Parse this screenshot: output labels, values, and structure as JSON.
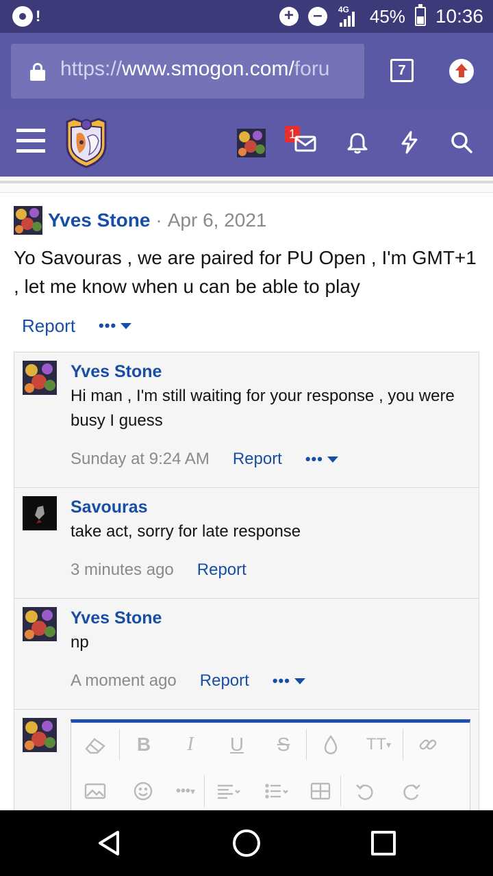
{
  "status_bar": {
    "battery": "45%",
    "time": "10:36",
    "network": "4G",
    "left_mark": "!"
  },
  "browser": {
    "url_protocol": "https://",
    "url_host": "www.smogon.com/",
    "url_rest": "foru",
    "tab_count": "7"
  },
  "site_header": {
    "notification_badge": "1",
    "icons": [
      "menu-icon",
      "site-logo",
      "user-avatar",
      "inbox-icon",
      "bell-icon",
      "lightning-icon",
      "search-icon"
    ]
  },
  "post": {
    "author": "Yves Stone",
    "separator": "·",
    "date": "Apr 6, 2021",
    "body": "Yo Savouras , we are paired for PU Open , I'm GMT+1 , let me know when u can be able to play",
    "report_label": "Report",
    "more_label": "•••"
  },
  "comments": [
    {
      "author": "Yves Stone",
      "text": "Hi man , I'm still waiting for your response , you were busy I guess",
      "time": "Sunday at 9:24 AM",
      "report_label": "Report",
      "more_label": "•••"
    },
    {
      "author": "Savouras",
      "text": "take act, sorry for late response",
      "time": "3 minutes ago",
      "report_label": "Report"
    },
    {
      "author": "Yves Stone",
      "text": "np",
      "time": "A moment ago",
      "report_label": "Report",
      "more_label": "•••"
    }
  ],
  "editor_toolbar": {
    "bold": "B",
    "italic": "I",
    "underline": "U",
    "strike": "S",
    "text_size": "TT",
    "more": "•••"
  },
  "colors": {
    "status_bar": "#3c3a78",
    "url_bar": "#5a59a6",
    "header": "#5d5ba8",
    "link": "#174ea6",
    "badge": "#e5302e",
    "editor_accent": "#1f4db0"
  }
}
